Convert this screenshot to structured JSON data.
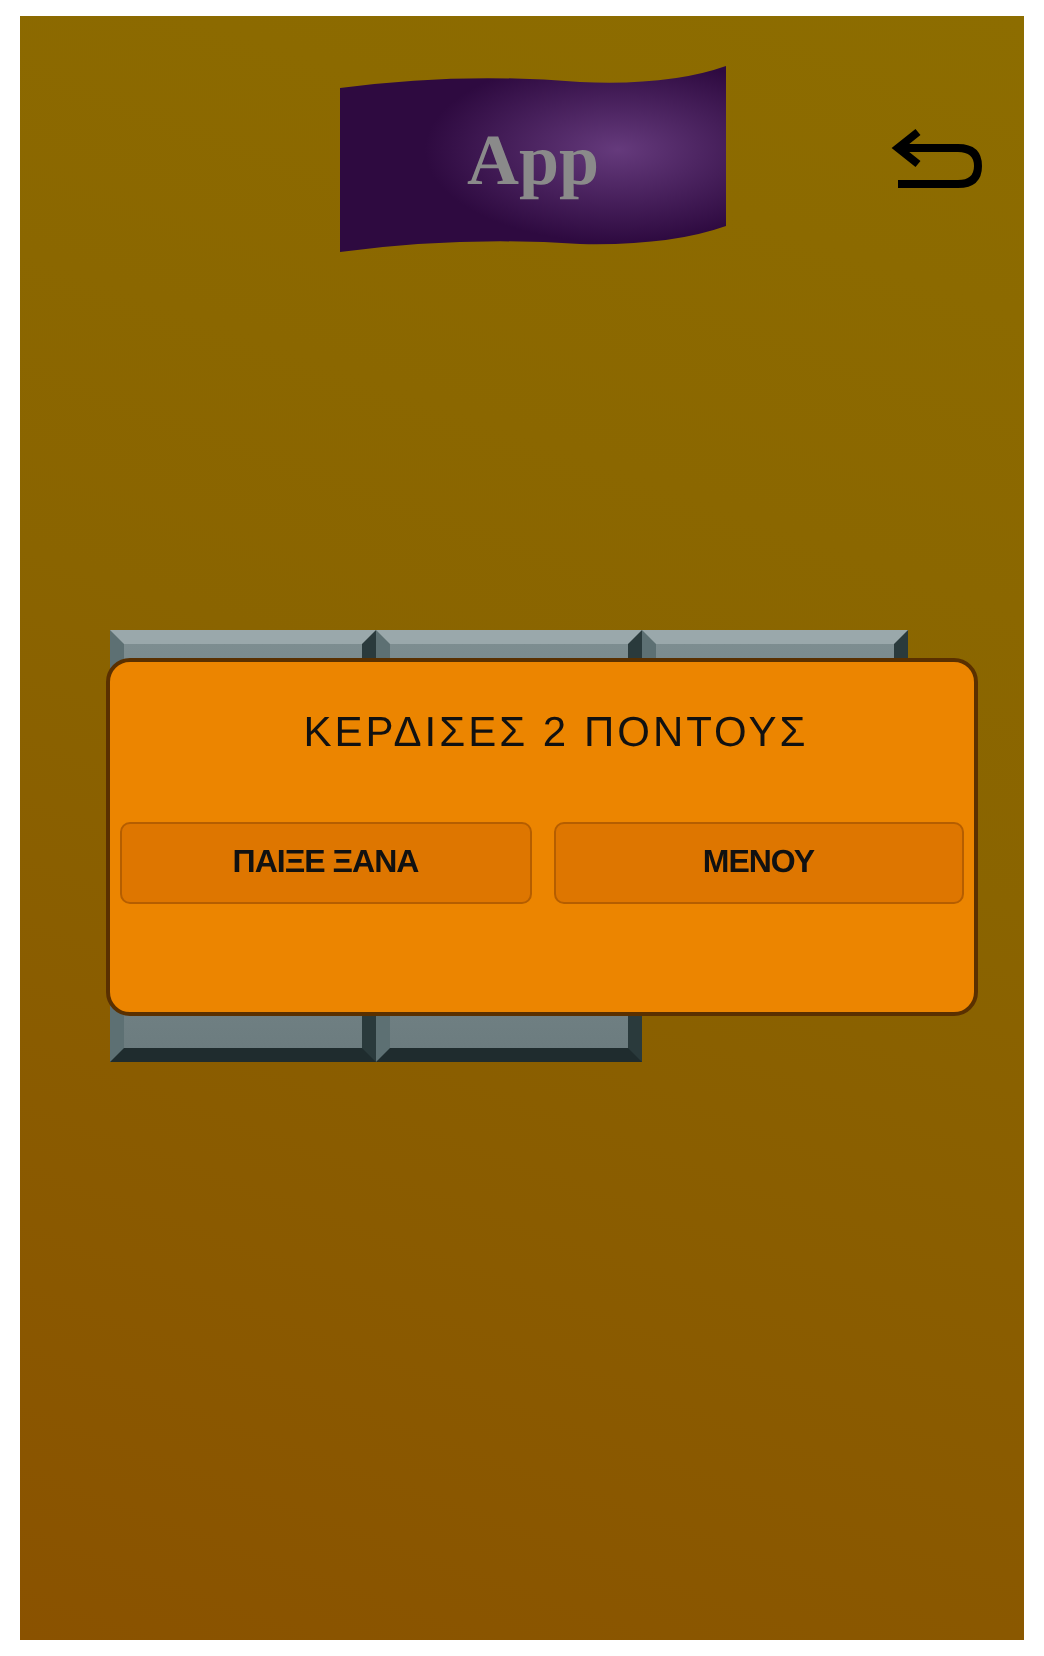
{
  "header": {
    "title": "App"
  },
  "dialog": {
    "message": "ΚΕΡΔΙΣΕΣ 2 ΠΟΝΤΟΥΣ",
    "buttons": [
      "ΠΑΙΞΕ ΞΑΝΑ",
      "ΜΕΝΟΥ"
    ]
  }
}
